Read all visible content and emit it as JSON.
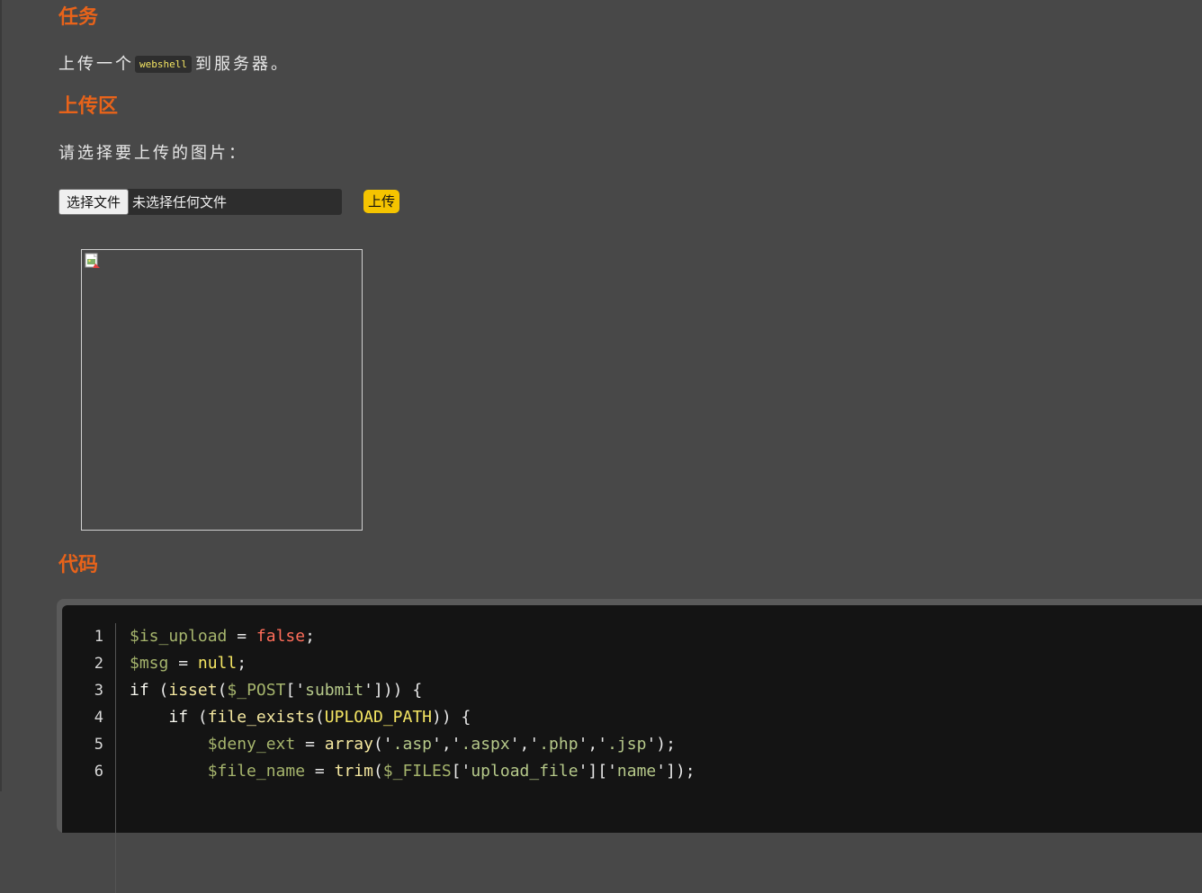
{
  "task": {
    "title": "任务",
    "text_before": "上传一个",
    "code": "webshell",
    "text_after": "到服务器。"
  },
  "upload": {
    "title": "上传区",
    "prompt": "请选择要上传的图片：",
    "choose_label": "选择文件",
    "file_status": "未选择任何文件",
    "submit_label": "上传"
  },
  "code_section": {
    "title": "代码",
    "lines": [
      {
        "num": "1",
        "tokens": [
          [
            "v",
            "$is_upload"
          ],
          [
            "p",
            " = "
          ],
          [
            "f",
            "false"
          ],
          [
            "p",
            ";"
          ]
        ]
      },
      {
        "num": "2",
        "tokens": [
          [
            "v",
            "$msg"
          ],
          [
            "p",
            " = "
          ],
          [
            "n",
            "null"
          ],
          [
            "p",
            ";"
          ]
        ]
      },
      {
        "num": "3",
        "tokens": [
          [
            "k",
            "if"
          ],
          [
            "p",
            " ("
          ],
          [
            "fn",
            "isset"
          ],
          [
            "p",
            "("
          ],
          [
            "v",
            "$_POST"
          ],
          [
            "p",
            "['"
          ],
          [
            "s",
            "submit"
          ],
          [
            "p",
            "'])) {"
          ]
        ]
      },
      {
        "num": "4",
        "tokens": [
          [
            "p",
            "    "
          ],
          [
            "k",
            "if"
          ],
          [
            "p",
            " ("
          ],
          [
            "fn",
            "file_exists"
          ],
          [
            "p",
            "("
          ],
          [
            "n",
            "UPLOAD_PATH"
          ],
          [
            "p",
            ")) {"
          ]
        ]
      },
      {
        "num": "5",
        "tokens": [
          [
            "p",
            "        "
          ],
          [
            "v",
            "$deny_ext"
          ],
          [
            "p",
            " = "
          ],
          [
            "fn",
            "array"
          ],
          [
            "p",
            "('"
          ],
          [
            "s",
            ".asp"
          ],
          [
            "p",
            "','"
          ],
          [
            "s",
            ".aspx"
          ],
          [
            "p",
            "','"
          ],
          [
            "s",
            ".php"
          ],
          [
            "p",
            "','"
          ],
          [
            "s",
            ".jsp"
          ],
          [
            "p",
            "');"
          ]
        ]
      },
      {
        "num": "6",
        "tokens": [
          [
            "p",
            "        "
          ],
          [
            "v",
            "$file_name"
          ],
          [
            "p",
            " = "
          ],
          [
            "fn",
            "trim"
          ],
          [
            "p",
            "("
          ],
          [
            "v",
            "$_FILES"
          ],
          [
            "p",
            "['"
          ],
          [
            "s",
            "upload_file"
          ],
          [
            "p",
            "']['"
          ],
          [
            "s",
            "name"
          ],
          [
            "p",
            "']);"
          ]
        ]
      }
    ]
  },
  "colors": {
    "heading": "#e8631a",
    "upload_button": "#f5c400",
    "background": "#484848"
  },
  "icons": {
    "broken_image": "broken-image-icon"
  }
}
